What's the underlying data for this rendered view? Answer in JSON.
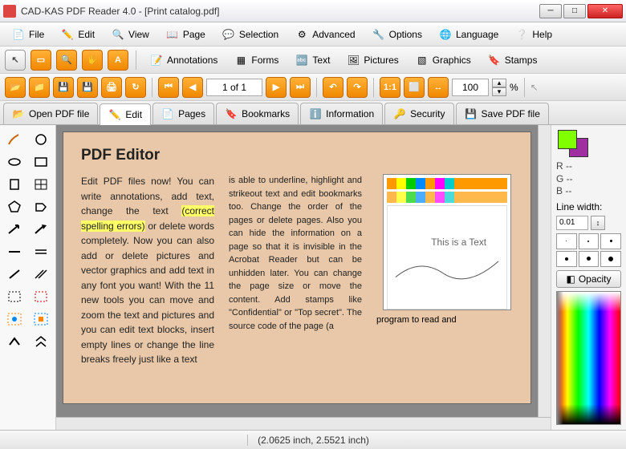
{
  "window": {
    "title": "CAD-KAS PDF Reader 4.0 - [Print catalog.pdf]"
  },
  "menu": {
    "file": "File",
    "edit": "Edit",
    "view": "View",
    "page": "Page",
    "selection": "Selection",
    "advanced": "Advanced",
    "options": "Options",
    "language": "Language",
    "help": "Help"
  },
  "toolbar1": {
    "annotations": "Annotations",
    "forms": "Forms",
    "text": "Text",
    "pictures": "Pictures",
    "graphics": "Graphics",
    "stamps": "Stamps"
  },
  "nav": {
    "page_of": "1 of 1",
    "zoom": "100",
    "percent": "%"
  },
  "tabs": {
    "open": "Open PDF file",
    "edit": "Edit",
    "pages": "Pages",
    "bookmarks": "Bookmarks",
    "information": "Information",
    "security": "Security",
    "save": "Save PDF file"
  },
  "doc": {
    "heading": "PDF Editor",
    "col1a": "Edit PDF files now! You can write annotations, add text, change the text ",
    "col1hl": "(correct spelling errors)",
    "col1b": " or delete words completely. Now you can also add or delete pictures and vector graphics and add text in any font you want! With the 11 new tools you can move and zoom the text and pictures and you can edit text blocks, insert empty lines or change the line breaks freely just like a text",
    "col2": "is able to underline, highlight and strikeout text and edit bookmarks too. Change the order of the pages or delete pages. Also you can hide the information on a page so that it is invisible in the Acrobat Reader but can be unhidden later. You can change the page size or move the content. Add stamps like \"Confidential\" or \"Top secret\". The source code of the page (a",
    "col3": "program to read and",
    "thumb_caption": "This is a Text"
  },
  "right": {
    "r": "R --",
    "g": "G --",
    "b": "B --",
    "linewidth_label": "Line width:",
    "linewidth": "0.01",
    "opacity": "Opacity"
  },
  "status": {
    "coords": "(2.0625 inch, 2.5521 inch)"
  }
}
